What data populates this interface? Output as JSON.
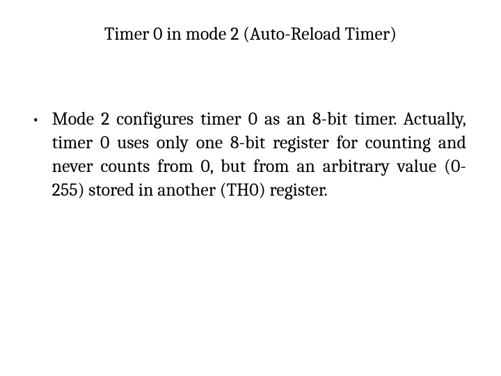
{
  "slide": {
    "title": "Timer 0 in mode 2 (Auto-Reload Timer)",
    "bullets": [
      {
        "text": "Mode 2 configures timer 0 as an 8-bit timer. Actually, timer 0 uses only one 8-bit register for counting and never counts from 0, but from an arbitrary value (0-255) stored in another (TH0) register."
      }
    ]
  }
}
